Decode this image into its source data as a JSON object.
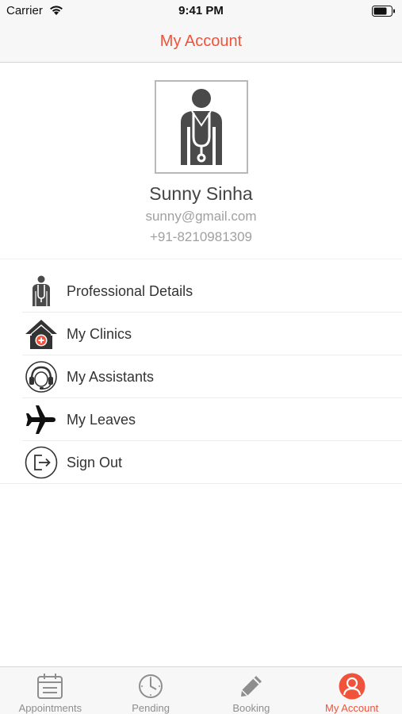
{
  "status_bar": {
    "carrier": "Carrier",
    "time": "9:41 PM"
  },
  "nav": {
    "title": "My Account"
  },
  "profile": {
    "name": "Sunny Sinha",
    "email": "sunny@gmail.com",
    "phone": "+91-8210981309"
  },
  "menu": {
    "items": [
      {
        "label": "Professional Details",
        "icon": "doctor-icon"
      },
      {
        "label": "My Clinics",
        "icon": "clinic-icon"
      },
      {
        "label": "My Assistants",
        "icon": "assistant-icon"
      },
      {
        "label": "My Leaves",
        "icon": "airplane-icon"
      },
      {
        "label": "Sign Out",
        "icon": "sign-out-icon"
      }
    ]
  },
  "tabs": [
    {
      "label": "Appointments",
      "icon": "calendar-icon",
      "active": false
    },
    {
      "label": "Pending",
      "icon": "clock-icon",
      "active": false
    },
    {
      "label": "Booking",
      "icon": "pencil-icon",
      "active": false
    },
    {
      "label": "My Account",
      "icon": "user-icon",
      "active": true
    }
  ],
  "colors": {
    "accent": "#f0533a",
    "inactive": "#8e8e8e",
    "bar_bg": "#f7f7f7"
  }
}
